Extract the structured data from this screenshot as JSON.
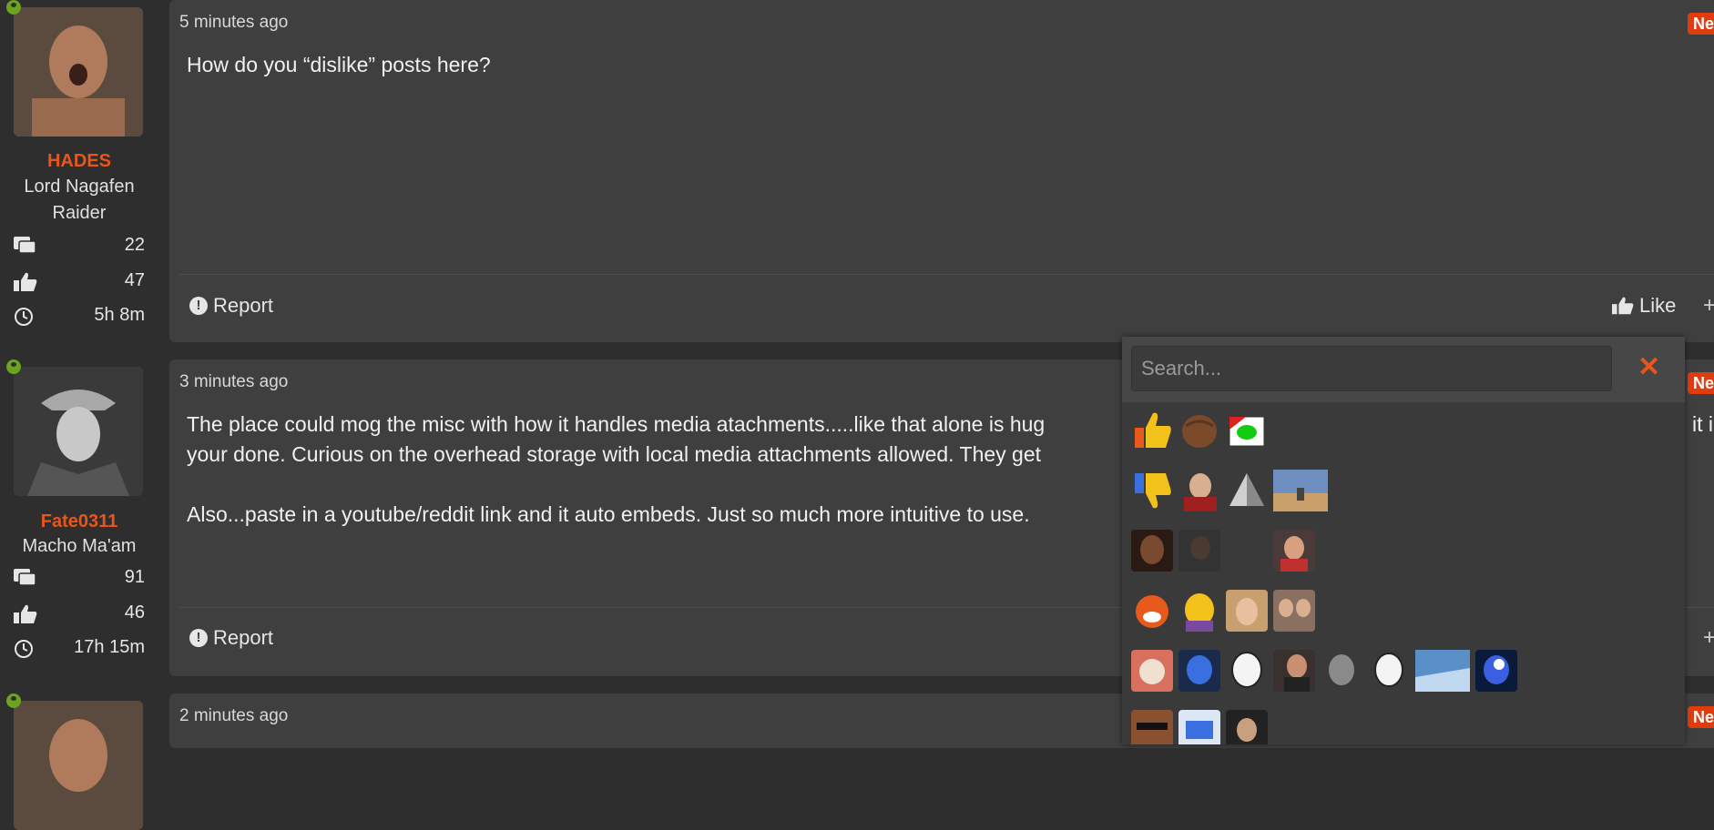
{
  "posts": [
    {
      "username": "HADES",
      "titles": [
        "Lord Nagafen",
        "Raider"
      ],
      "messages": "22",
      "likes": "47",
      "time_online": "5h 8m",
      "time": "5 minutes ago",
      "body": [
        "How do you “dislike” posts here?"
      ],
      "report": "Report",
      "like": "Like",
      "badge": "Ne"
    },
    {
      "username": "Fate0311",
      "titles": [
        "Macho Ma'am"
      ],
      "messages": "91",
      "likes": "46",
      "time_online": "17h 15m",
      "time": "3 minutes ago",
      "body": [
        "The place could mog the misc with how it handles media atachments.....like that alone is hug",
        "your done. Curious on the overhead storage with local media attachments allowed. They get",
        "",
        "Also...paste in a youtube/reddit link and it auto embeds. Just so much more intuitive to use."
      ],
      "body_right_fragment": "it i",
      "report": "Report",
      "badge": "Ne"
    },
    {
      "time": "2 minutes ago",
      "badge": "Ne"
    }
  ],
  "reaction_picker": {
    "search_placeholder": "Search...",
    "close_icon": "close-icon",
    "accent": "#e8561c"
  },
  "colors": {
    "username": "#e8561c",
    "badge": "#e03c10",
    "online": "#6ca31f"
  }
}
